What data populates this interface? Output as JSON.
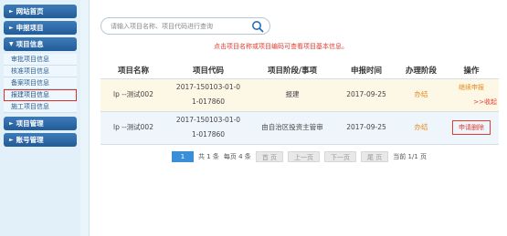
{
  "sidebar": {
    "sections": [
      {
        "label": "网站首页",
        "arrow": "►"
      },
      {
        "label": "申报项目",
        "arrow": "►"
      },
      {
        "label": "项目信息",
        "arrow": "▼"
      },
      {
        "label": "项目管理",
        "arrow": "►"
      },
      {
        "label": "账号管理",
        "arrow": "►"
      }
    ],
    "sub_items": [
      "审批项目信息",
      "核准项目信息",
      "备案项目信息",
      "报建项目信息",
      "施工项目信息"
    ]
  },
  "search": {
    "placeholder": "请输入项目名称、项目代码进行查询"
  },
  "hint": "点击项目名称或项目编码可查看项目基本信息。",
  "table": {
    "headers": [
      "项目名称",
      "项目代码",
      "项目阶段/事项",
      "申报时间",
      "办理阶段",
      "操作"
    ],
    "rows": [
      {
        "name": "lp --测试002",
        "code_line1": "2017-150103-01-0",
        "code_line2": "1-017860",
        "stage": "报建",
        "date": "2017-09-25",
        "status": "办结",
        "op": "继续申报",
        "op2": ">>收起"
      },
      {
        "name": "lp --测试002",
        "code_line1": "2017-150103-01-0",
        "code_line2": "1-017860",
        "stage": "由自治区投资主管审",
        "date": "2017-09-25",
        "status": "办结",
        "op": "申请删除"
      }
    ]
  },
  "pager": {
    "current": "1",
    "total": "共 1 条",
    "per_page": "每页 4 条",
    "first": "首 页",
    "prev": "上一页",
    "next": "下一页",
    "last": "尾 页",
    "page_info": "当前 1/1 页"
  }
}
